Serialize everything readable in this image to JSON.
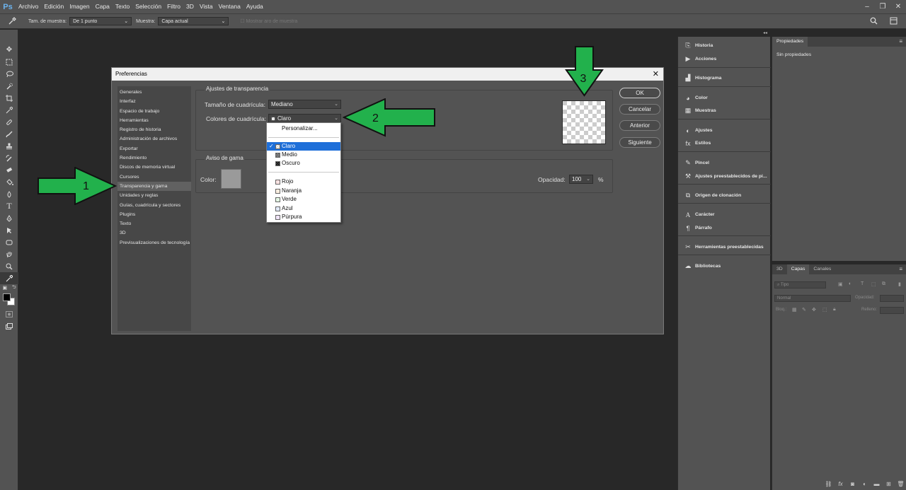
{
  "app": {
    "logo": "Ps"
  },
  "menu": [
    "Archivo",
    "Edición",
    "Imagen",
    "Capa",
    "Texto",
    "Selección",
    "Filtro",
    "3D",
    "Vista",
    "Ventana",
    "Ayuda"
  ],
  "window_controls": [
    "–",
    "❐",
    "✕"
  ],
  "options": {
    "sample_size_label": "Tam. de muestra:",
    "sample_size_value": "De 1 punto",
    "sample_label": "Muestra:",
    "sample_value": "Capa actual",
    "show_ring_label": "Mostrar aro de muestra"
  },
  "dialog": {
    "title": "Preferencias",
    "close": "✕",
    "categories": [
      "Generales",
      "Interfaz",
      "Espacio de trabajo",
      "Herramientas",
      "Registro de historia",
      "Administración de archivos",
      "Exportar",
      "Rendimiento",
      "Discos de memoria virtual",
      "Cursores",
      "Transparencia y gama",
      "Unidades y reglas",
      "Guías, cuadrícula y sectores",
      "Plugins",
      "Texto",
      "3D",
      "Previsualizaciones de tecnología"
    ],
    "selected_category": "Transparencia y gama",
    "transparency": {
      "group_title": "Ajustes de transparencia",
      "grid_size_label": "Tamaño de cuadrícula:",
      "grid_size_value": "Mediano",
      "grid_colors_label": "Colores de cuadrícula:",
      "grid_colors_value": "Claro"
    },
    "gamut": {
      "group_title": "Aviso de gama",
      "color_label": "Color:",
      "color_value": "#9a9a9a",
      "opacity_label": "Opacidad:",
      "opacity_value": "100",
      "opacity_unit": "%"
    },
    "buttons": {
      "ok": "OK",
      "cancel": "Cancelar",
      "prev": "Anterior",
      "next": "Siguiente"
    },
    "dropdown": {
      "custom": "Personalizar...",
      "options": [
        {
          "label": "Claro",
          "selected": true
        },
        {
          "label": "Medio",
          "selected": false
        },
        {
          "label": "Oscuro",
          "selected": false
        },
        {
          "label": "Rojo",
          "selected": false
        },
        {
          "label": "Naranja",
          "selected": false
        },
        {
          "label": "Verde",
          "selected": false
        },
        {
          "label": "Azul",
          "selected": false
        },
        {
          "label": "Púrpura",
          "selected": false
        }
      ],
      "check": "✓"
    }
  },
  "annotations": [
    "1",
    "2",
    "3"
  ],
  "annotation_color": "#22b14c",
  "dock": [
    "Historia",
    "Acciones",
    "Histograma",
    "Color",
    "Muestras",
    "Ajustes",
    "Estilos",
    "Pincel",
    "Ajustes preestablecidos de pi...",
    "Origen de clonación",
    "Carácter",
    "Párrafo",
    "Herramientas preestablecidas",
    "Bibliotecas"
  ],
  "properties_panel": {
    "tab": "Propiedades",
    "empty": "Sin propiedades"
  },
  "layers_panel": {
    "tabs": [
      "3D",
      "Capas",
      "Canales"
    ],
    "active_tab": "Capas",
    "filter_placeholder": "Tipo",
    "blend_mode": "Normal",
    "opacity_label": "Opacidad:",
    "lock_label": "Bloq.:",
    "fill_label": "Relleno:"
  }
}
